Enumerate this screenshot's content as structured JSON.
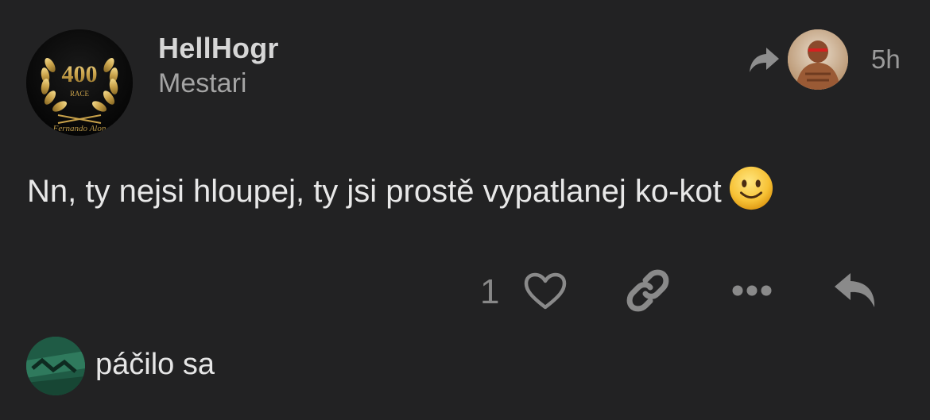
{
  "post": {
    "author": {
      "username": "HellHogr",
      "title": "Mestari",
      "avatar": {
        "badge_number": "400",
        "badge_word": "RACE",
        "caption": "Fernando Alon"
      }
    },
    "reply_to": {
      "icon": "reply-arrow-icon",
      "avatar": "reply-target-avatar"
    },
    "time": "5h",
    "body": "Nn, ty nejsi hloupej, ty jsi prostě vypatlanej ko-kot",
    "emoji": "slightly-smiling-face",
    "actions": {
      "like_count": "1",
      "icons": [
        "heart-icon",
        "link-icon",
        "more-dots-icon",
        "reply-icon"
      ]
    }
  },
  "liked_by": {
    "text": "páčilo sa",
    "avatar": "liker-avatar"
  },
  "colors": {
    "background": "#222223",
    "username": "#d6d6d6",
    "muted": "#a4a4a4",
    "icon": "#888888",
    "text": "#e8e8e8"
  }
}
